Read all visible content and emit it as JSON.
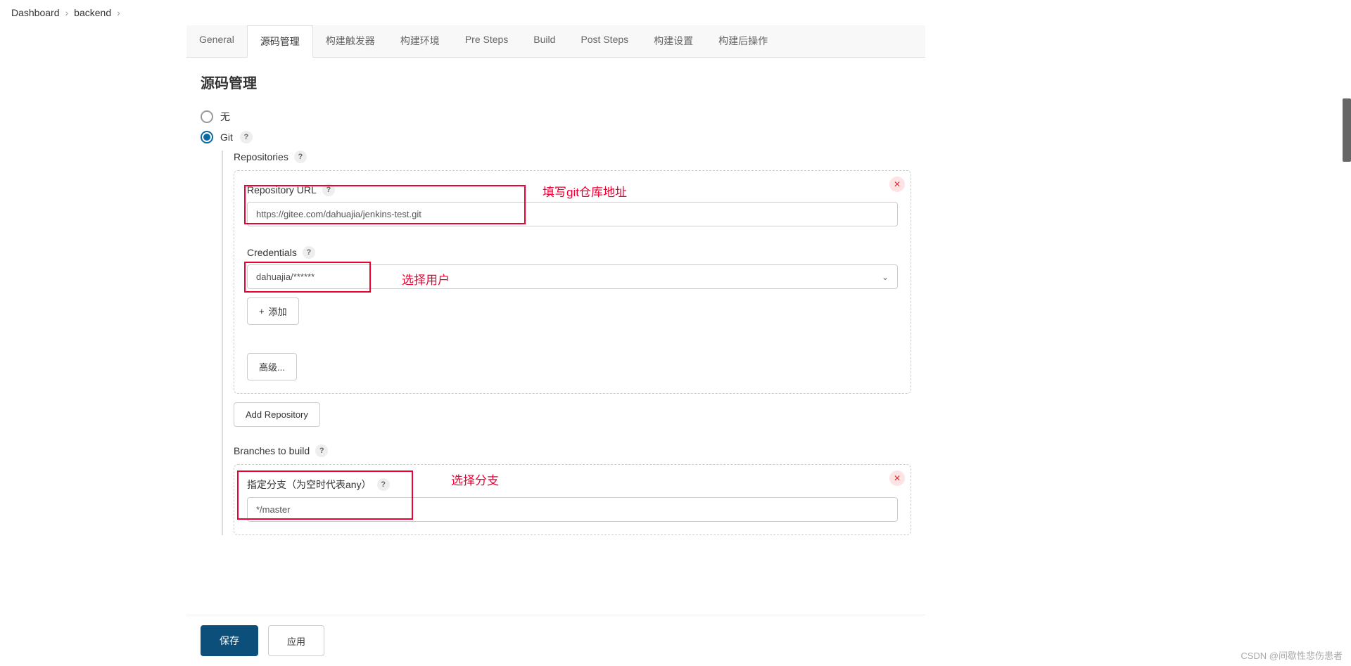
{
  "breadcrumb": {
    "item1": "Dashboard",
    "item2": "backend"
  },
  "tabs": {
    "general": "General",
    "scm": "源码管理",
    "triggers": "构建触发器",
    "env": "构建环境",
    "pre": "Pre Steps",
    "build": "Build",
    "post": "Post Steps",
    "settings": "构建设置",
    "postbuild": "构建后操作"
  },
  "section": {
    "title": "源码管理"
  },
  "radios": {
    "none": "无",
    "git": "Git"
  },
  "git": {
    "repositories_label": "Repositories",
    "repo_url_label": "Repository URL",
    "repo_url_value": "https://gitee.com/dahuajia/jenkins-test.git",
    "credentials_label": "Credentials",
    "credentials_value": "dahuajia/******",
    "add_btn": "添加",
    "advanced_btn": "高级...",
    "add_repo_btn": "Add Repository",
    "branches_label": "Branches to build",
    "branch_spec_label": "指定分支（为空时代表any）",
    "branch_value": "*/master"
  },
  "annotations": {
    "fill_repo": "填写git仓库地址",
    "select_user": "选择用户",
    "select_branch": "选择分支"
  },
  "actions": {
    "save": "保存",
    "apply": "应用"
  },
  "watermark": "CSDN @间歇性悲伤患者"
}
